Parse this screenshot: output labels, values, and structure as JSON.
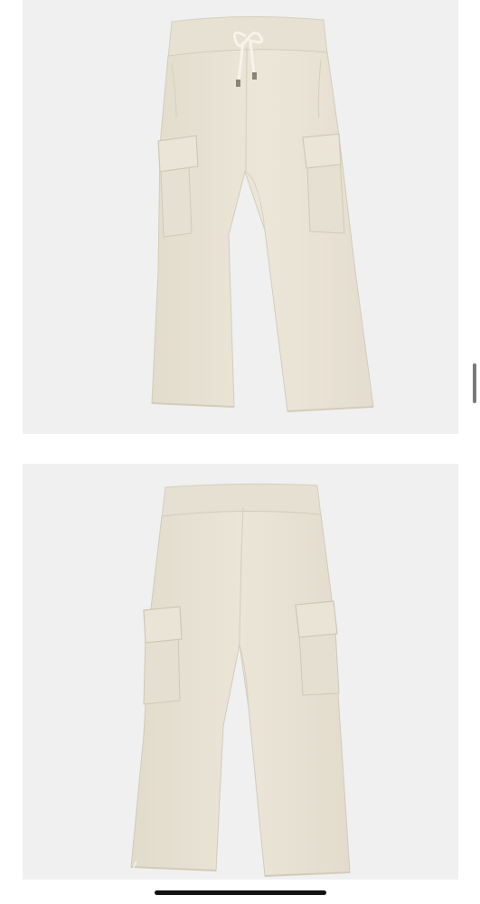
{
  "gallery": {
    "images": [
      {
        "view": "front",
        "subject": "cargo-sweatpants-front",
        "color": "#ebe5d8"
      },
      {
        "view": "back",
        "subject": "cargo-sweatpants-back",
        "color": "#ebe5d8"
      }
    ],
    "background_color": "#f0f0f0"
  }
}
